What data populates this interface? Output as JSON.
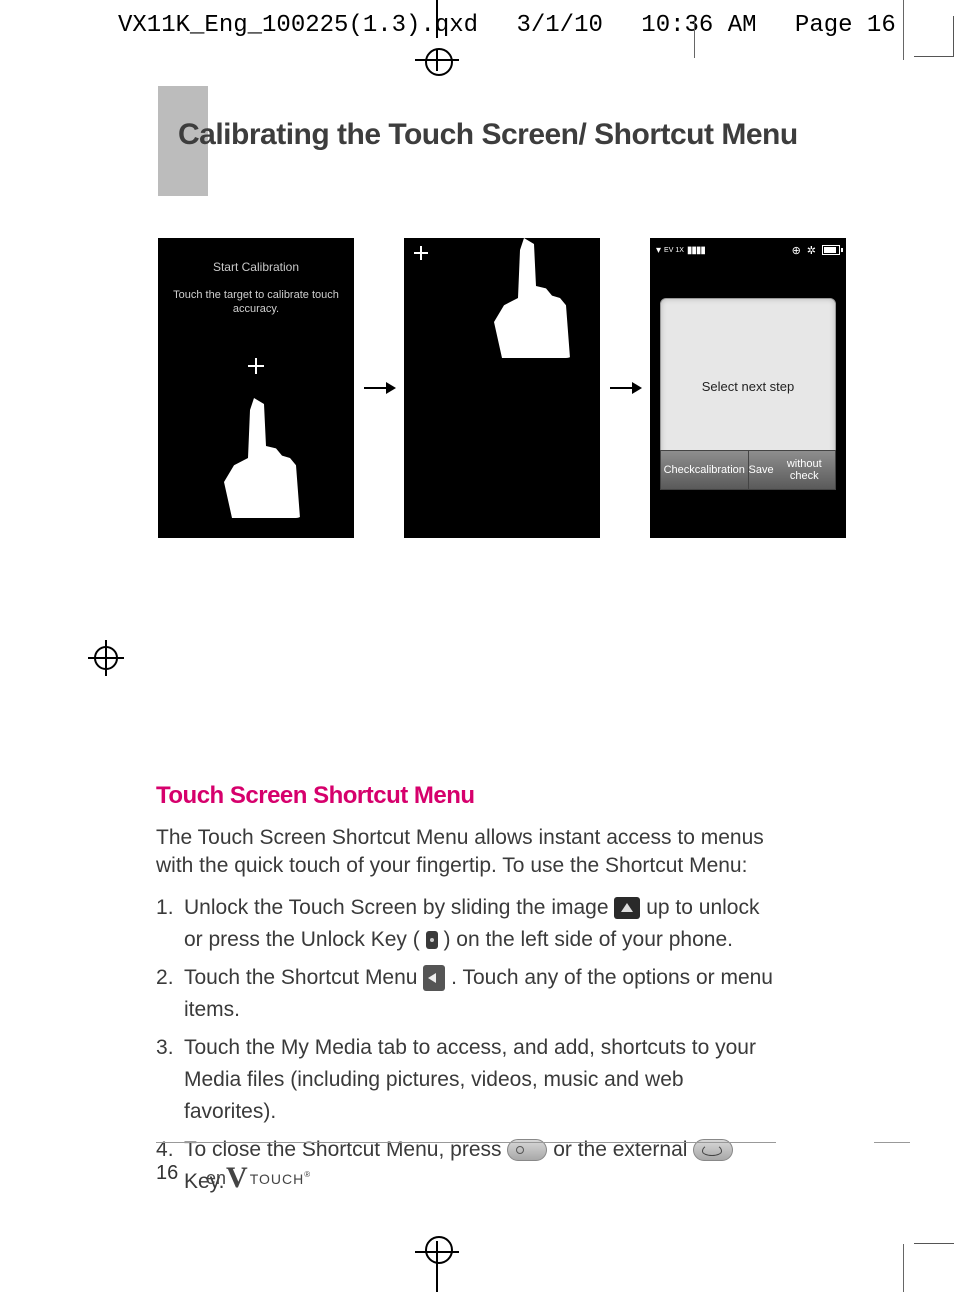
{
  "proof": {
    "filename": "VX11K_Eng_100225(1.3).qxd",
    "date": "3/1/10",
    "time": "10:36 AM",
    "pageref": "Page 16"
  },
  "title": "Calibrating the Touch Screen/ Shortcut Menu",
  "screens": {
    "s1": {
      "heading": "Start Calibration",
      "body": "Touch the target to calibrate touch accuracy."
    },
    "s3": {
      "status_left": "EV 1X",
      "prompt": "Select next step",
      "btn1_line1": "Check",
      "btn1_line2": "calibration",
      "btn2_line1": "Save",
      "btn2_line2": "without check"
    }
  },
  "section": {
    "heading": "Touch Screen Shortcut Menu",
    "intro": "The Touch Screen Shortcut Menu allows instant access to menus with the quick touch of your fingertip. To use the Shortcut Menu:",
    "step1a": "Unlock the Touch Screen by sliding the image",
    "step1b": "up to unlock or press the Unlock Key (",
    "step1c": ") on the left side of your phone.",
    "step2a": "Touch the Shortcut Menu",
    "step2b": ". Touch any of the options or menu items.",
    "step3": "Touch the My Media tab to access, and add, shortcuts to your Media files (including pictures, videos, music and web favorites).",
    "step4a": "To close the Shortcut Menu, press",
    "step4b": "or the external",
    "step4c": "Key."
  },
  "footer": {
    "page": "16",
    "brand_pre": "en",
    "brand_v": "V",
    "brand_suffix": "TOUCH",
    "reg": "®"
  }
}
